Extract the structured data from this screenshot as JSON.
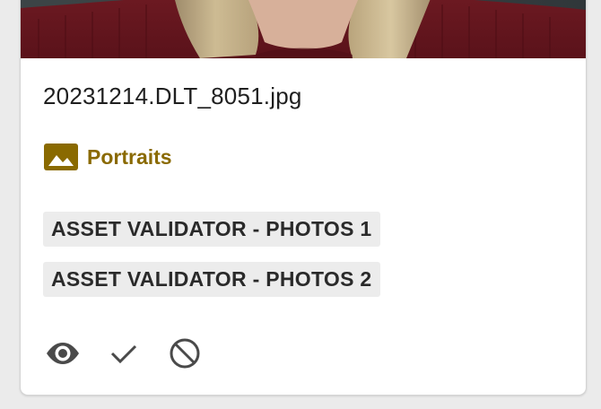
{
  "asset": {
    "filename": "20231214.DLT_8051.jpg",
    "collection": {
      "label": "Portraits",
      "icon": "image-icon",
      "color": "#8a6a00"
    },
    "tags": [
      "ASSET VALIDATOR - PHOTOS 1",
      "ASSET VALIDATOR - PHOTOS 2"
    ],
    "actions": [
      {
        "icon": "eye-icon",
        "name": "view"
      },
      {
        "icon": "check-icon",
        "name": "approve"
      },
      {
        "icon": "block-icon",
        "name": "reject"
      }
    ]
  }
}
